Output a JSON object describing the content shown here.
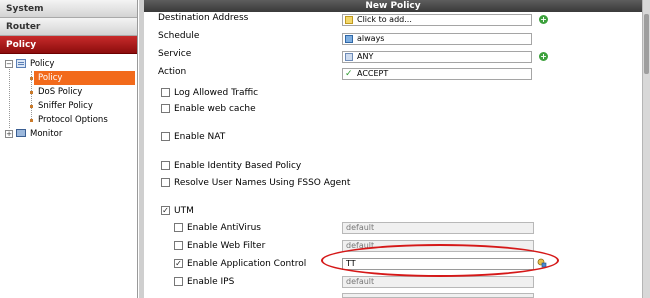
{
  "sidebar": {
    "sections": [
      {
        "label": "System",
        "active": false
      },
      {
        "label": "Router",
        "active": false
      },
      {
        "label": "Policy",
        "active": true
      }
    ],
    "tree": {
      "policy_group": "Policy",
      "items": [
        "Policy",
        "DoS Policy",
        "Sniffer Policy",
        "Protocol Options"
      ],
      "selected": "Policy",
      "monitor": "Monitor"
    }
  },
  "panel": {
    "title": "New Policy",
    "fields": {
      "destination_address": {
        "label": "Destination Address",
        "value": "Click to add..."
      },
      "schedule": {
        "label": "Schedule",
        "value": "always"
      },
      "service": {
        "label": "Service",
        "value": "ANY"
      },
      "action": {
        "label": "Action",
        "value": "ACCEPT"
      }
    },
    "options": {
      "log_allowed_traffic": {
        "label": "Log Allowed Traffic",
        "checked": false
      },
      "enable_web_cache": {
        "label": "Enable web cache",
        "checked": false
      },
      "enable_nat": {
        "label": "Enable NAT",
        "checked": false
      },
      "enable_identity_policy": {
        "label": "Enable Identity Based Policy",
        "checked": false
      },
      "resolve_user_names": {
        "label": "Resolve User Names Using FSSO Agent",
        "checked": false
      },
      "utm": {
        "label": "UTM",
        "checked": true
      }
    },
    "utm_options": [
      {
        "label": "Enable AntiVirus",
        "checked": false,
        "profile": "default",
        "enabled": false
      },
      {
        "label": "Enable Web Filter",
        "checked": false,
        "profile": "default",
        "enabled": false
      },
      {
        "label": "Enable Application Control",
        "checked": true,
        "profile": "TT",
        "enabled": true
      },
      {
        "label": "Enable IPS",
        "checked": false,
        "profile": "default",
        "enabled": false
      }
    ],
    "check_mark": "✓",
    "add_symbol": "+"
  },
  "colors": {
    "active_section": "#a51b1b",
    "selected_item": "#f26a1b",
    "title_bar": "#4a4a4a",
    "highlight_ellipse": "#d51818",
    "add_button": "#3ca03c"
  }
}
